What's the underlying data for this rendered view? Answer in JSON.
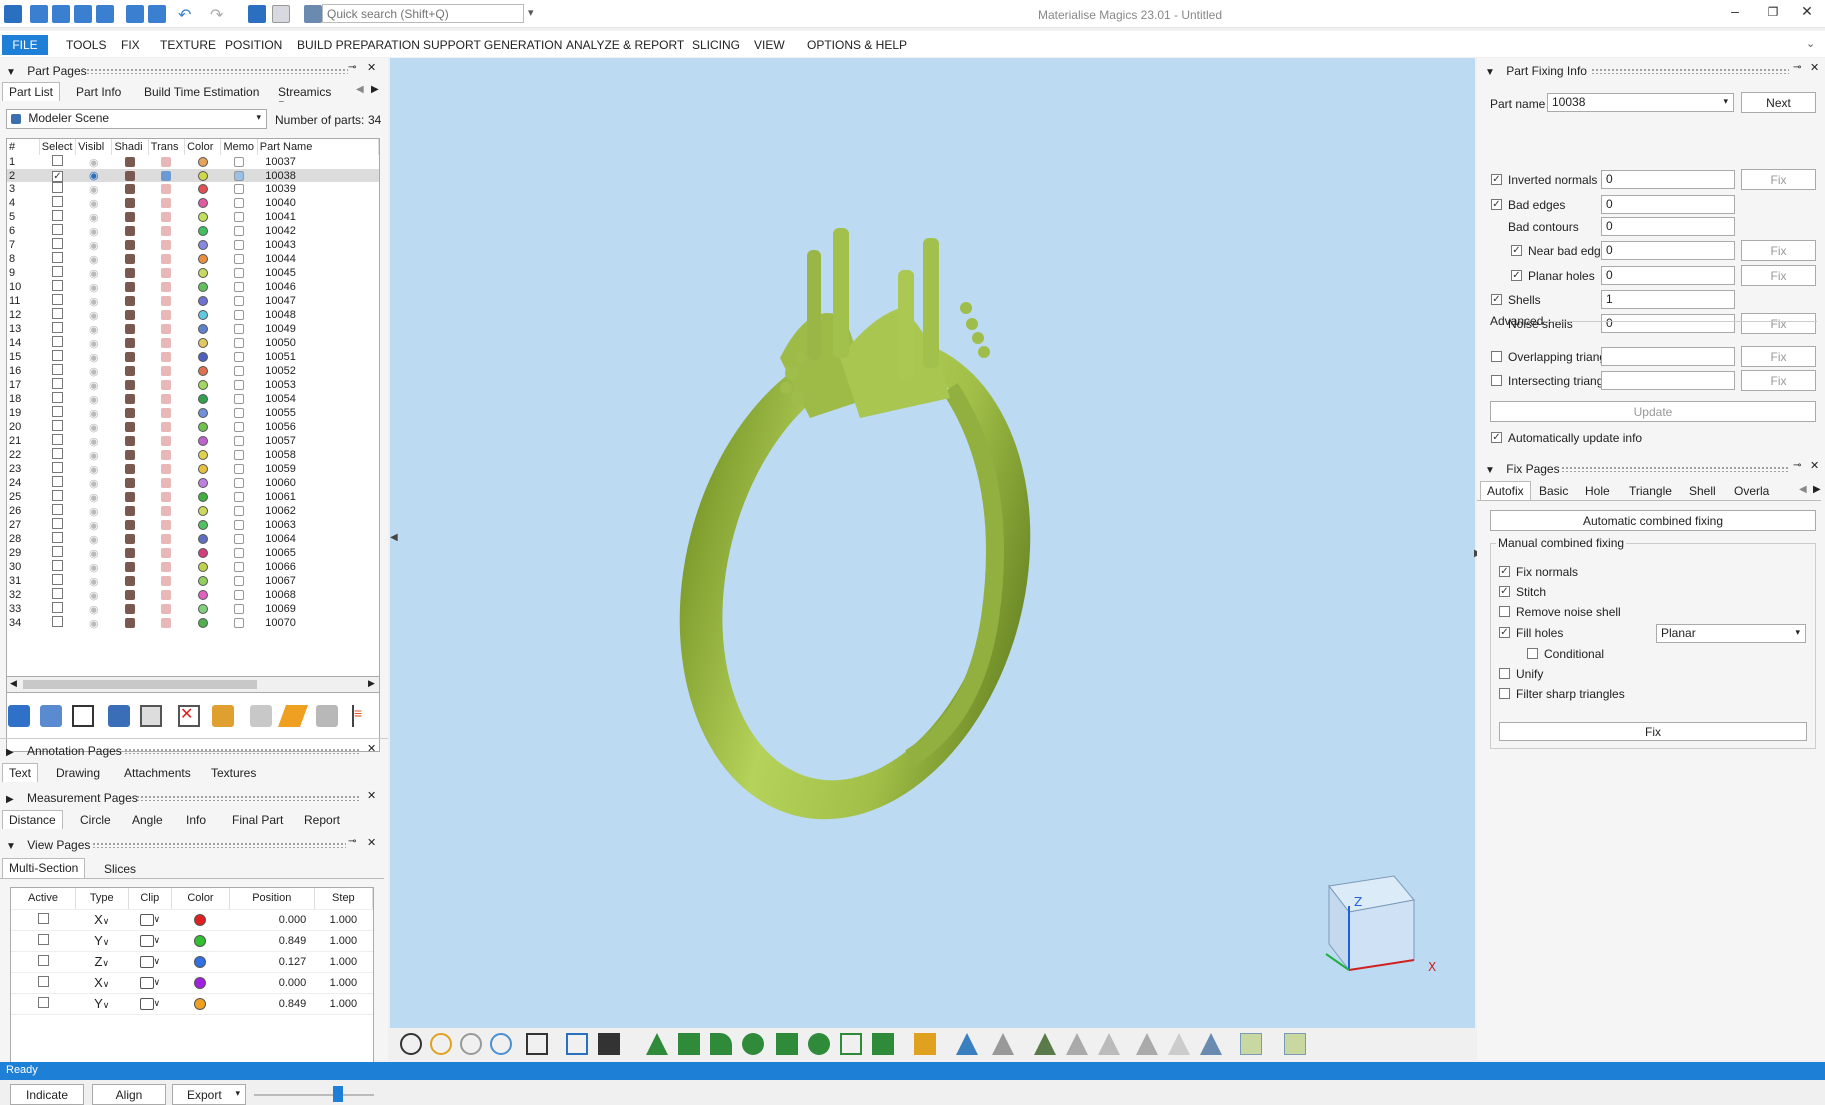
{
  "window": {
    "title": "Materialise Magics 23.01 - Untitled",
    "search_placeholder": "Quick search (Shift+Q)"
  },
  "menu": [
    "FILE",
    "TOOLS",
    "FIX",
    "TEXTURE",
    "POSITION",
    "BUILD PREPARATION",
    "SUPPORT GENERATION",
    "ANALYZE & REPORT",
    "SLICING",
    "VIEW",
    "OPTIONS & HELP"
  ],
  "part_pages": {
    "title": "Part Pages",
    "tabs": [
      "Part List",
      "Part Info",
      "Build Time Estimation",
      "Streamics Part"
    ],
    "scene": "Modeler Scene",
    "num_parts_label": "Number of parts:",
    "num_parts": "34",
    "columns": [
      "#",
      "Select",
      "Visibl",
      "Shadi",
      "Trans",
      "Color",
      "Memo",
      "Part Name"
    ],
    "selected_row": 2,
    "rows": [
      {
        "n": "1",
        "name": "10037",
        "color": "#e8a35a"
      },
      {
        "n": "2",
        "name": "10038",
        "color": "#cfd84a"
      },
      {
        "n": "3",
        "name": "10039",
        "color": "#e05050"
      },
      {
        "n": "4",
        "name": "10040",
        "color": "#e05aa0"
      },
      {
        "n": "5",
        "name": "10041",
        "color": "#c0e060"
      },
      {
        "n": "6",
        "name": "10042",
        "color": "#40c060"
      },
      {
        "n": "7",
        "name": "10043",
        "color": "#8888e0"
      },
      {
        "n": "8",
        "name": "10044",
        "color": "#e89040"
      },
      {
        "n": "9",
        "name": "10045",
        "color": "#c8d860"
      },
      {
        "n": "10",
        "name": "10046",
        "color": "#60c060"
      },
      {
        "n": "11",
        "name": "10047",
        "color": "#7070d0"
      },
      {
        "n": "12",
        "name": "10048",
        "color": "#60c8e0"
      },
      {
        "n": "13",
        "name": "10049",
        "color": "#6080d0"
      },
      {
        "n": "14",
        "name": "10050",
        "color": "#e0c860"
      },
      {
        "n": "15",
        "name": "10051",
        "color": "#5060c0"
      },
      {
        "n": "16",
        "name": "10052",
        "color": "#e07050"
      },
      {
        "n": "17",
        "name": "10053",
        "color": "#a0d860"
      },
      {
        "n": "18",
        "name": "10054",
        "color": "#30a050"
      },
      {
        "n": "19",
        "name": "10055",
        "color": "#7090d8"
      },
      {
        "n": "20",
        "name": "10056",
        "color": "#70c050"
      },
      {
        "n": "21",
        "name": "10057",
        "color": "#c060d0"
      },
      {
        "n": "22",
        "name": "10058",
        "color": "#e0d050"
      },
      {
        "n": "23",
        "name": "10059",
        "color": "#e8c040"
      },
      {
        "n": "24",
        "name": "10060",
        "color": "#c080e0"
      },
      {
        "n": "25",
        "name": "10061",
        "color": "#40b040"
      },
      {
        "n": "26",
        "name": "10062",
        "color": "#d0d860"
      },
      {
        "n": "27",
        "name": "10063",
        "color": "#50c060"
      },
      {
        "n": "28",
        "name": "10064",
        "color": "#6070c0"
      },
      {
        "n": "29",
        "name": "10065",
        "color": "#d04080"
      },
      {
        "n": "30",
        "name": "10066",
        "color": "#c0d050"
      },
      {
        "n": "31",
        "name": "10067",
        "color": "#90d060"
      },
      {
        "n": "32",
        "name": "10068",
        "color": "#e060c0"
      },
      {
        "n": "33",
        "name": "10069",
        "color": "#80d080"
      },
      {
        "n": "34",
        "name": "10070",
        "color": "#50b050"
      }
    ]
  },
  "annotation_pages": {
    "title": "Annotation Pages",
    "tabs": [
      "Text",
      "Drawing",
      "Attachments",
      "Textures"
    ]
  },
  "measurement_pages": {
    "title": "Measurement Pages",
    "tabs": [
      "Distance",
      "Circle",
      "Angle",
      "Info",
      "Final Part",
      "Report"
    ]
  },
  "view_pages": {
    "title": "View Pages",
    "tabs": [
      "Multi-Section",
      "Slices"
    ],
    "columns": [
      "Active",
      "Type",
      "Clip",
      "Color",
      "Position",
      "Step"
    ],
    "rows": [
      {
        "type": "X",
        "color": "#e02020",
        "position": "0.000",
        "step": "1.000"
      },
      {
        "type": "Y",
        "color": "#30c030",
        "position": "0.849",
        "step": "1.000"
      },
      {
        "type": "Z",
        "color": "#3070e0",
        "position": "0.127",
        "step": "1.000"
      },
      {
        "type": "X",
        "color": "#a020e0",
        "position": "0.000",
        "step": "1.000"
      },
      {
        "type": "Y",
        "color": "#f0a020",
        "position": "0.849",
        "step": "1.000"
      }
    ],
    "buttons": {
      "indicate": "Indicate",
      "align": "Align",
      "export": "Export"
    },
    "slider_level": 0.72
  },
  "part_fixing": {
    "title": "Part Fixing Info",
    "part_name_label": "Part name",
    "part_name": "10038",
    "next": "Next",
    "fix": "Fix",
    "items": [
      {
        "label": "Inverted normals",
        "checked": true,
        "value": "0",
        "fix": true,
        "indent": 0
      },
      {
        "label": "Bad edges",
        "checked": true,
        "value": "0",
        "fix": false,
        "indent": 0
      },
      {
        "label": "Bad contours",
        "checked": null,
        "value": "0",
        "fix": false,
        "indent": 1
      },
      {
        "label": "Near bad edges",
        "checked": true,
        "value": "0",
        "fix": true,
        "indent": 2
      },
      {
        "label": "Planar holes",
        "checked": true,
        "value": "0",
        "fix": true,
        "indent": 2
      },
      {
        "label": "Shells",
        "checked": true,
        "value": "1",
        "fix": false,
        "indent": 0
      },
      {
        "label": "Noise shells",
        "checked": null,
        "value": "0",
        "fix": true,
        "indent": 1
      }
    ],
    "advanced_label": "Advanced",
    "advanced": [
      {
        "label": "Overlapping triangles",
        "value": ""
      },
      {
        "label": "Intersecting triangles",
        "value": ""
      }
    ],
    "update": "Update",
    "auto_update": "Automatically update info"
  },
  "fix_pages": {
    "title": "Fix Pages",
    "tabs": [
      "Autofix",
      "Basic",
      "Hole",
      "Triangle",
      "Shell",
      "Overla"
    ],
    "auto_combined": "Automatic combined fixing",
    "manual_label": "Manual combined fixing",
    "options": [
      {
        "label": "Fix normals",
        "checked": true
      },
      {
        "label": "Stitch",
        "checked": true
      },
      {
        "label": "Remove noise shell",
        "checked": false
      },
      {
        "label": "Fill holes",
        "checked": true
      },
      {
        "label": "Conditional",
        "checked": false
      },
      {
        "label": "Unify",
        "checked": false
      },
      {
        "label": "Filter sharp triangles",
        "checked": false
      }
    ],
    "fill_mode": "Planar",
    "fix": "Fix"
  },
  "viewport": {
    "model_color": "#a8c84a",
    "bg": "#bcdaf2",
    "axis_z": "Z",
    "axis_x": "X"
  },
  "status": "Ready"
}
